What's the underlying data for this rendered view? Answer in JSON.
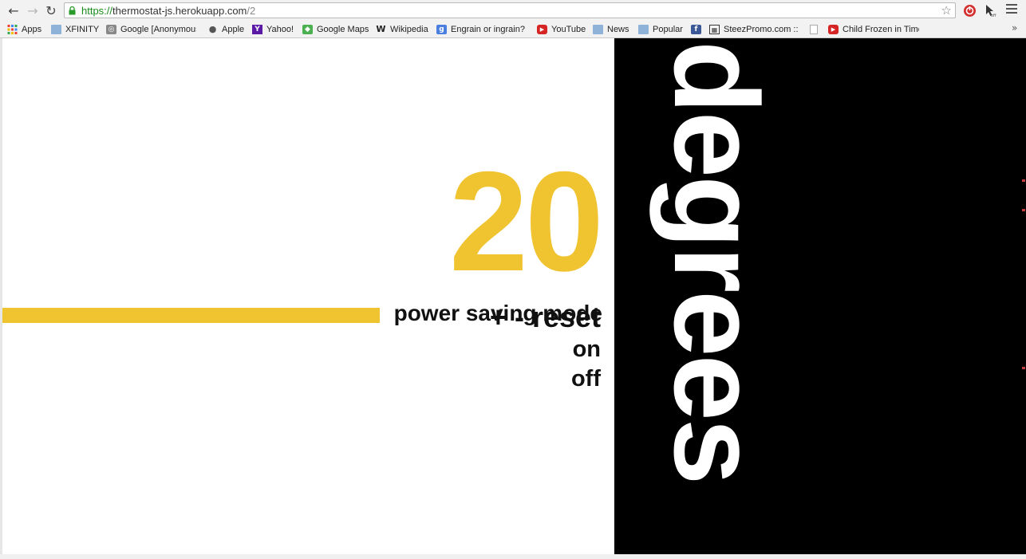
{
  "browser": {
    "url_scheme": "https://",
    "url_host": "thermostat-js.herokuapp.com",
    "url_path": "/2",
    "bookmarks": [
      {
        "label": "Apps",
        "icon": "apps-grid-icon"
      },
      {
        "label": "XFINITY",
        "icon": "folder-icon"
      },
      {
        "label": "Google [Anonymous",
        "icon": "google-anonymous-icon"
      },
      {
        "label": "Apple",
        "icon": "apple-icon"
      },
      {
        "label": "Yahoo!",
        "icon": "yahoo-icon"
      },
      {
        "label": "Google Maps",
        "icon": "google-maps-icon"
      },
      {
        "label": "Wikipedia",
        "icon": "wikipedia-icon"
      },
      {
        "label": "Engrain or ingrain? (",
        "icon": "google-icon"
      },
      {
        "label": "YouTube",
        "icon": "youtube-icon"
      },
      {
        "label": "News",
        "icon": "folder-icon"
      },
      {
        "label": "Popular",
        "icon": "folder-icon"
      },
      {
        "label": "",
        "icon": "facebook-icon"
      },
      {
        "label": "SteezPromo.com :: I",
        "icon": "steezpromo-icon"
      },
      {
        "label": "",
        "icon": "blank-page-icon"
      },
      {
        "label": "Child Frozen in Time",
        "icon": "youtube-icon"
      }
    ],
    "overflow_label": "»"
  },
  "thermostat": {
    "temperature": "20",
    "increase_label": "+",
    "decrease_label": "-",
    "reset_label": "reset",
    "psm_label": "power saving mode",
    "psm_on_label": "on",
    "psm_off_label": "off",
    "unit_word": "degrees",
    "colors": {
      "accent": "#f0c330",
      "panel": "#000000",
      "text": "#111111"
    }
  }
}
